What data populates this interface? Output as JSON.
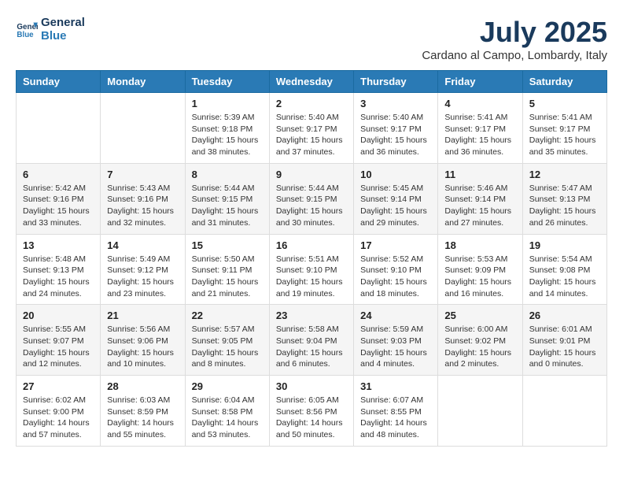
{
  "logo": {
    "line1": "General",
    "line2": "Blue"
  },
  "title": "July 2025",
  "subtitle": "Cardano al Campo, Lombardy, Italy",
  "headers": [
    "Sunday",
    "Monday",
    "Tuesday",
    "Wednesday",
    "Thursday",
    "Friday",
    "Saturday"
  ],
  "weeks": [
    [
      {
        "day": "",
        "info": ""
      },
      {
        "day": "",
        "info": ""
      },
      {
        "day": "1",
        "info": "Sunrise: 5:39 AM\nSunset: 9:18 PM\nDaylight: 15 hours\nand 38 minutes."
      },
      {
        "day": "2",
        "info": "Sunrise: 5:40 AM\nSunset: 9:17 PM\nDaylight: 15 hours\nand 37 minutes."
      },
      {
        "day": "3",
        "info": "Sunrise: 5:40 AM\nSunset: 9:17 PM\nDaylight: 15 hours\nand 36 minutes."
      },
      {
        "day": "4",
        "info": "Sunrise: 5:41 AM\nSunset: 9:17 PM\nDaylight: 15 hours\nand 36 minutes."
      },
      {
        "day": "5",
        "info": "Sunrise: 5:41 AM\nSunset: 9:17 PM\nDaylight: 15 hours\nand 35 minutes."
      }
    ],
    [
      {
        "day": "6",
        "info": "Sunrise: 5:42 AM\nSunset: 9:16 PM\nDaylight: 15 hours\nand 33 minutes."
      },
      {
        "day": "7",
        "info": "Sunrise: 5:43 AM\nSunset: 9:16 PM\nDaylight: 15 hours\nand 32 minutes."
      },
      {
        "day": "8",
        "info": "Sunrise: 5:44 AM\nSunset: 9:15 PM\nDaylight: 15 hours\nand 31 minutes."
      },
      {
        "day": "9",
        "info": "Sunrise: 5:44 AM\nSunset: 9:15 PM\nDaylight: 15 hours\nand 30 minutes."
      },
      {
        "day": "10",
        "info": "Sunrise: 5:45 AM\nSunset: 9:14 PM\nDaylight: 15 hours\nand 29 minutes."
      },
      {
        "day": "11",
        "info": "Sunrise: 5:46 AM\nSunset: 9:14 PM\nDaylight: 15 hours\nand 27 minutes."
      },
      {
        "day": "12",
        "info": "Sunrise: 5:47 AM\nSunset: 9:13 PM\nDaylight: 15 hours\nand 26 minutes."
      }
    ],
    [
      {
        "day": "13",
        "info": "Sunrise: 5:48 AM\nSunset: 9:13 PM\nDaylight: 15 hours\nand 24 minutes."
      },
      {
        "day": "14",
        "info": "Sunrise: 5:49 AM\nSunset: 9:12 PM\nDaylight: 15 hours\nand 23 minutes."
      },
      {
        "day": "15",
        "info": "Sunrise: 5:50 AM\nSunset: 9:11 PM\nDaylight: 15 hours\nand 21 minutes."
      },
      {
        "day": "16",
        "info": "Sunrise: 5:51 AM\nSunset: 9:10 PM\nDaylight: 15 hours\nand 19 minutes."
      },
      {
        "day": "17",
        "info": "Sunrise: 5:52 AM\nSunset: 9:10 PM\nDaylight: 15 hours\nand 18 minutes."
      },
      {
        "day": "18",
        "info": "Sunrise: 5:53 AM\nSunset: 9:09 PM\nDaylight: 15 hours\nand 16 minutes."
      },
      {
        "day": "19",
        "info": "Sunrise: 5:54 AM\nSunset: 9:08 PM\nDaylight: 15 hours\nand 14 minutes."
      }
    ],
    [
      {
        "day": "20",
        "info": "Sunrise: 5:55 AM\nSunset: 9:07 PM\nDaylight: 15 hours\nand 12 minutes."
      },
      {
        "day": "21",
        "info": "Sunrise: 5:56 AM\nSunset: 9:06 PM\nDaylight: 15 hours\nand 10 minutes."
      },
      {
        "day": "22",
        "info": "Sunrise: 5:57 AM\nSunset: 9:05 PM\nDaylight: 15 hours\nand 8 minutes."
      },
      {
        "day": "23",
        "info": "Sunrise: 5:58 AM\nSunset: 9:04 PM\nDaylight: 15 hours\nand 6 minutes."
      },
      {
        "day": "24",
        "info": "Sunrise: 5:59 AM\nSunset: 9:03 PM\nDaylight: 15 hours\nand 4 minutes."
      },
      {
        "day": "25",
        "info": "Sunrise: 6:00 AM\nSunset: 9:02 PM\nDaylight: 15 hours\nand 2 minutes."
      },
      {
        "day": "26",
        "info": "Sunrise: 6:01 AM\nSunset: 9:01 PM\nDaylight: 15 hours\nand 0 minutes."
      }
    ],
    [
      {
        "day": "27",
        "info": "Sunrise: 6:02 AM\nSunset: 9:00 PM\nDaylight: 14 hours\nand 57 minutes."
      },
      {
        "day": "28",
        "info": "Sunrise: 6:03 AM\nSunset: 8:59 PM\nDaylight: 14 hours\nand 55 minutes."
      },
      {
        "day": "29",
        "info": "Sunrise: 6:04 AM\nSunset: 8:58 PM\nDaylight: 14 hours\nand 53 minutes."
      },
      {
        "day": "30",
        "info": "Sunrise: 6:05 AM\nSunset: 8:56 PM\nDaylight: 14 hours\nand 50 minutes."
      },
      {
        "day": "31",
        "info": "Sunrise: 6:07 AM\nSunset: 8:55 PM\nDaylight: 14 hours\nand 48 minutes."
      },
      {
        "day": "",
        "info": ""
      },
      {
        "day": "",
        "info": ""
      }
    ]
  ]
}
